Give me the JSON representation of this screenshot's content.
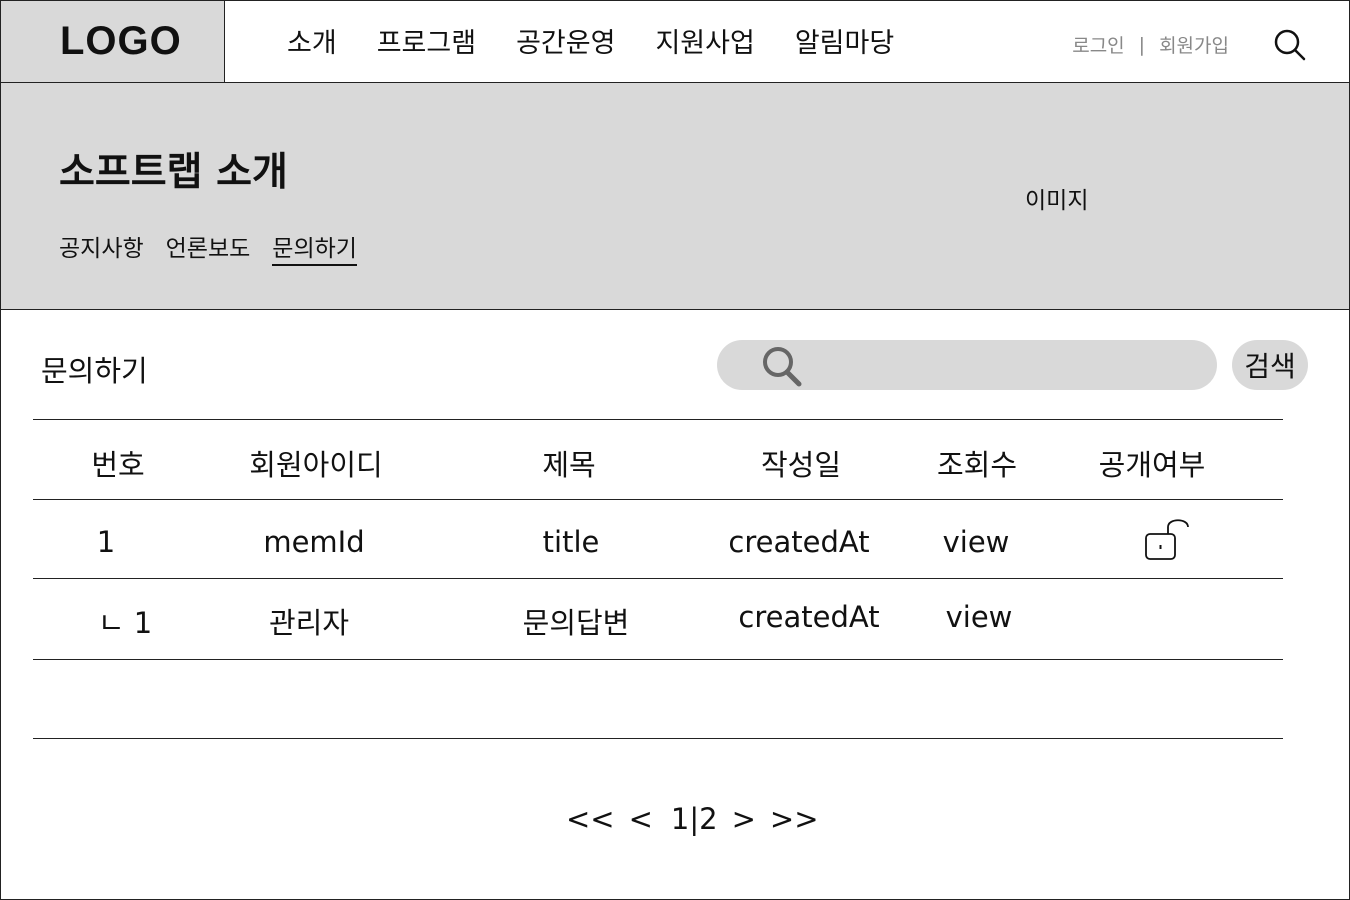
{
  "header": {
    "logo": "LOGO",
    "nav": [
      "소개",
      "프로그램",
      "공간운영",
      "지원사업",
      "알림마당"
    ],
    "login": "로그인",
    "separator": "|",
    "signup": "회원가입",
    "search_icon": "search-icon"
  },
  "banner": {
    "title": "소프트랩 소개",
    "subnav": [
      "공지사항",
      "언론보도",
      "문의하기"
    ],
    "active_subnav": "문의하기",
    "image_placeholder": "이미지"
  },
  "content": {
    "title": "문의하기",
    "search_placeholder": "",
    "search_button": "검색"
  },
  "table": {
    "columns": [
      "번호",
      "회원아이디",
      "제목",
      "작성일",
      "조회수",
      "공개여부"
    ],
    "rows": [
      {
        "no": "1",
        "member_id": "memId",
        "title": "title",
        "created_at": "createdAt",
        "views": "view",
        "visibility_icon": "unlock-icon"
      },
      {
        "no": "ㄴ 1",
        "member_id": "관리자",
        "title": "문의답변",
        "created_at": "createdAt",
        "views": "view",
        "visibility_icon": ""
      }
    ]
  },
  "pagination": {
    "first": "<<",
    "prev": "<",
    "page1": "1",
    "divider": "|",
    "page2": "2",
    "next": ">",
    "last": ">>"
  },
  "colors": {
    "gray_fill": "#d9d9d9",
    "line": "#222222",
    "muted_text": "#888888"
  }
}
